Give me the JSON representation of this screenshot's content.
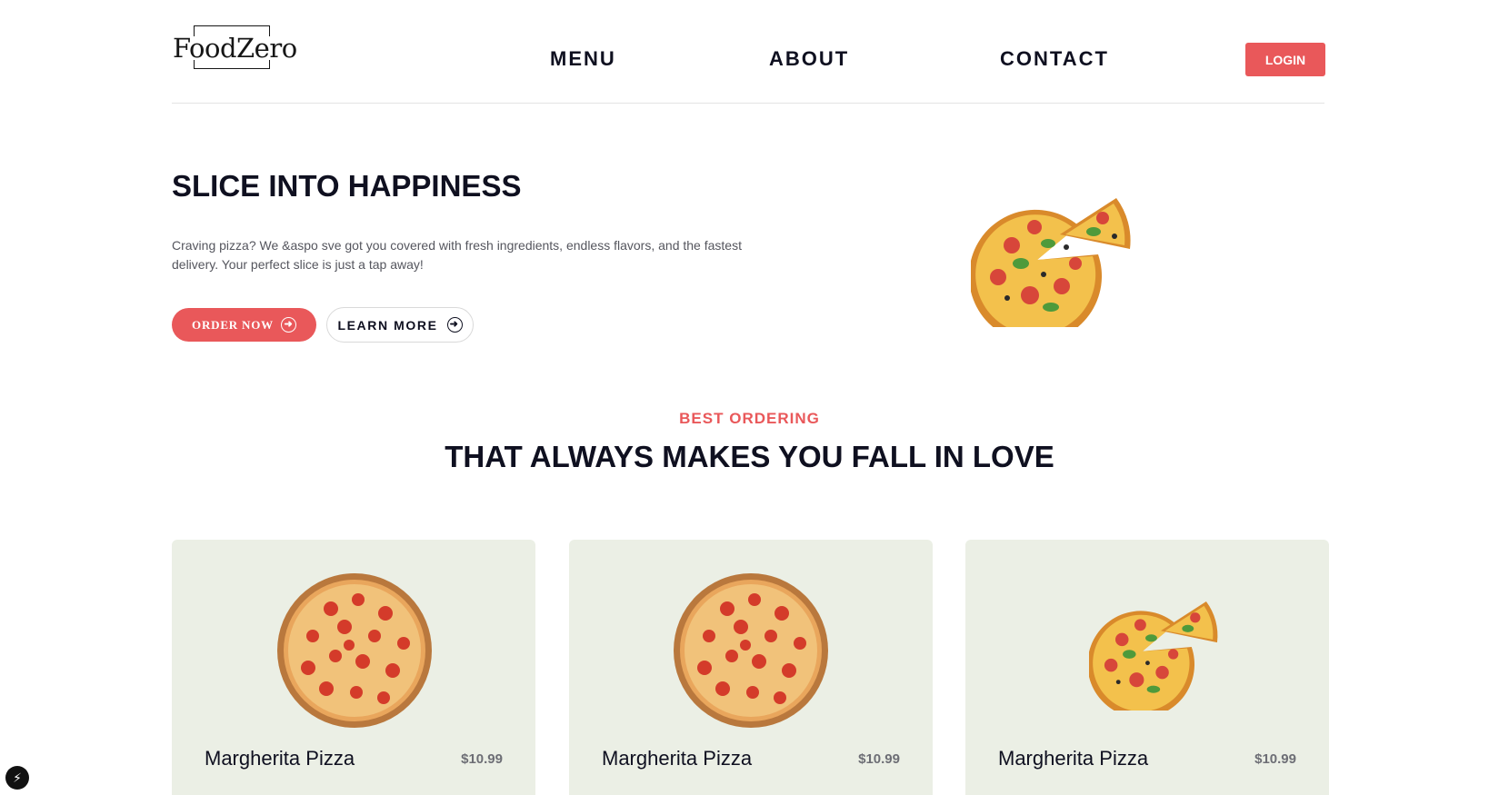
{
  "header": {
    "logo": "FoodZero",
    "nav": [
      "MENU",
      "ABOUT",
      "CONTACT"
    ],
    "login_label": "LOGIN"
  },
  "hero": {
    "title": "SLICE INTO HAPPINESS",
    "description": "Craving pizza? We &aspo sve got you covered with fresh ingredients, endless flavors, and the fastest delivery. Your perfect slice is just a tap away!",
    "order_label": "ORDER NOW",
    "learn_label": "LEARN MORE"
  },
  "section": {
    "eyebrow": "BEST ORDERING",
    "title": "THAT ALWAYS MAKES YOU FALL IN LOVE"
  },
  "cards": [
    {
      "name": "Margherita Pizza",
      "price": "$10.99",
      "image": "pepperoni-pizza-image"
    },
    {
      "name": "Margherita Pizza",
      "price": "$10.99",
      "image": "pepperoni-pizza-image"
    },
    {
      "name": "Margherita Pizza",
      "price": "$10.99",
      "image": "sliced-pizza-image"
    }
  ],
  "colors": {
    "accent": "#e9585a",
    "card_bg": "#ebefe5",
    "text_dark": "#0f1020"
  }
}
